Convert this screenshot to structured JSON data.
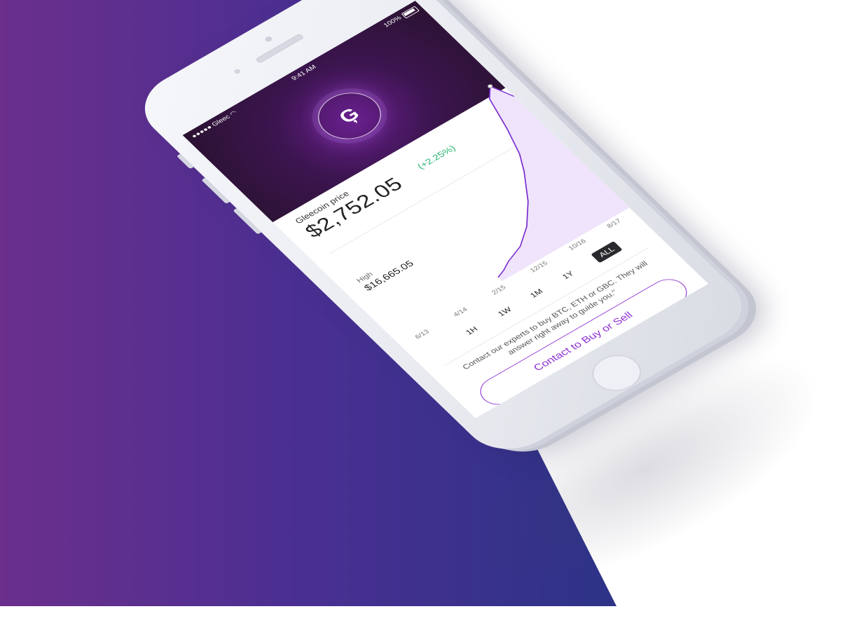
{
  "status_bar": {
    "carrier": "●●●●● Gleec",
    "time": "9:41 AM",
    "battery": "100%"
  },
  "header": {
    "logo_glyph": "Ģ"
  },
  "price_panel": {
    "label": "Gleecoin price",
    "value": "$2,752.05",
    "change": "(+2.25%)"
  },
  "stats": {
    "high_label": "High",
    "high_value": "$16,665.05"
  },
  "chart_data": {
    "type": "line",
    "x_labels": [
      "6/13",
      "4/14",
      "2/15",
      "12/15",
      "10/16",
      "8/17"
    ],
    "series": [
      {
        "values": [
          0.03,
          0.05,
          0.08,
          0.1,
          0.12,
          0.16,
          0.2,
          0.26,
          0.32,
          0.4,
          0.48,
          0.58,
          0.74,
          0.94,
          1.0,
          0.88
        ]
      }
    ],
    "colors": {
      "line": "#7b2fd0",
      "fill": "#efe4fb"
    }
  },
  "time_ranges": {
    "options": [
      "1H",
      "1W",
      "1M",
      "1Y",
      "ALL"
    ],
    "selected": "ALL"
  },
  "cta": {
    "text": "Contact our experts to buy BTC, ETH or GBC. They will answer right away to guide you.\"",
    "button_label": "Contact to Buy or Sell"
  }
}
